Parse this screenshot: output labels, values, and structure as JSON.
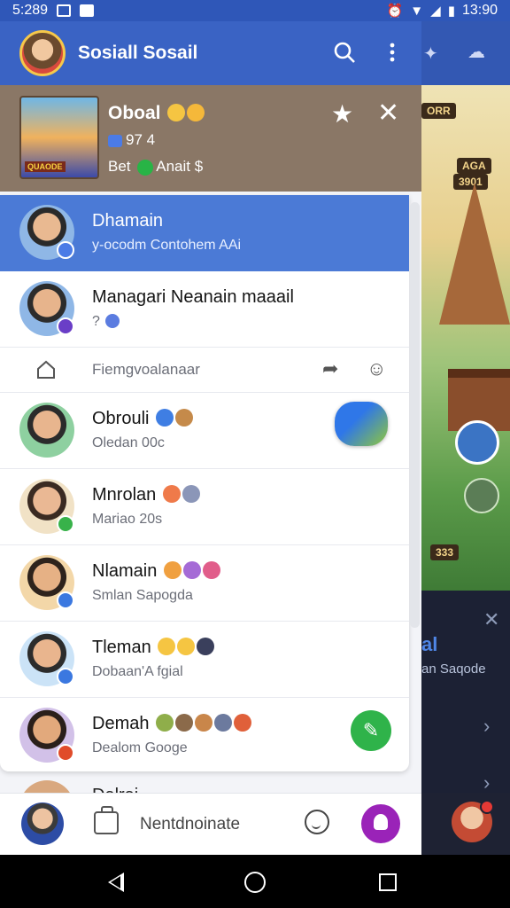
{
  "status_bar": {
    "time_left": "5:289",
    "time_right": "13:90"
  },
  "background_app": {
    "tag_top": "ORR",
    "tag_mid": "AGA",
    "tag_mid2": "3901",
    "tag_bottom": "333",
    "dark_title": "al",
    "dark_sub": "an Saqode"
  },
  "drawer": {
    "title": "Sosiall Sosail",
    "game_card": {
      "title": "Oboal",
      "line1": "97 4",
      "line2_prefix": "Bet",
      "line2_suffix": "Anait $",
      "thumb_label": "QUAODE"
    },
    "chats": [
      {
        "name": "Dhamain",
        "sub": "y-ocodm Contohem AAi",
        "badge_color": "#4b7be6",
        "avatar_bg": "#8fb7e6",
        "shirt": "#1f3f7a"
      },
      {
        "name": "Managari Neanain maaail",
        "sub": "?",
        "badge_color": "#6a3ec7",
        "avatar_bg": "#8fb7e6",
        "shirt": "#203d7e"
      },
      {
        "name": "Obrouli",
        "sub": "Oledan 00c",
        "badge_color": "",
        "avatar_bg": "#8ed0a0",
        "shirt": "#1d4e93"
      },
      {
        "name": "Mnrolan",
        "sub": "Mariao 20s",
        "badge_color": "#38b24a",
        "avatar_bg": "#f1e2c6",
        "shirt": "#b93a33"
      },
      {
        "name": "Nlamain",
        "sub": "Smlan Sapogda",
        "badge_color": "#3b78e0",
        "avatar_bg": "#f3d7a8",
        "shirt": "#7a4a2a"
      },
      {
        "name": "Tleman",
        "sub": "Dobaan'A fgial",
        "badge_color": "#3b78e0",
        "avatar_bg": "#cbe3f7",
        "shirt": "#1e47a0"
      },
      {
        "name": "Demah",
        "sub": "Dealom Googe",
        "badge_color": "#e04b2a",
        "avatar_bg": "#d2c1e8",
        "shirt": "#2b2f54"
      }
    ],
    "sub_row_label": "Fiemgvoalanaar",
    "peek_name": "Dalrai",
    "bottom_bar": {
      "label": "Nentdnoinate"
    }
  },
  "colors": {
    "header_blue": "#3a63c4",
    "highlight_blue": "#4b7ad6",
    "fab_purple": "#9a23b8",
    "green": "#2fb34a"
  },
  "icons": [
    "search-icon",
    "more-vert-icon",
    "star-icon",
    "close-icon",
    "home-icon",
    "forward-icon",
    "emoji-icon",
    "message-icon",
    "briefcase-icon",
    "person-icon",
    "back-icon",
    "circle-home-icon",
    "recents-icon"
  ]
}
